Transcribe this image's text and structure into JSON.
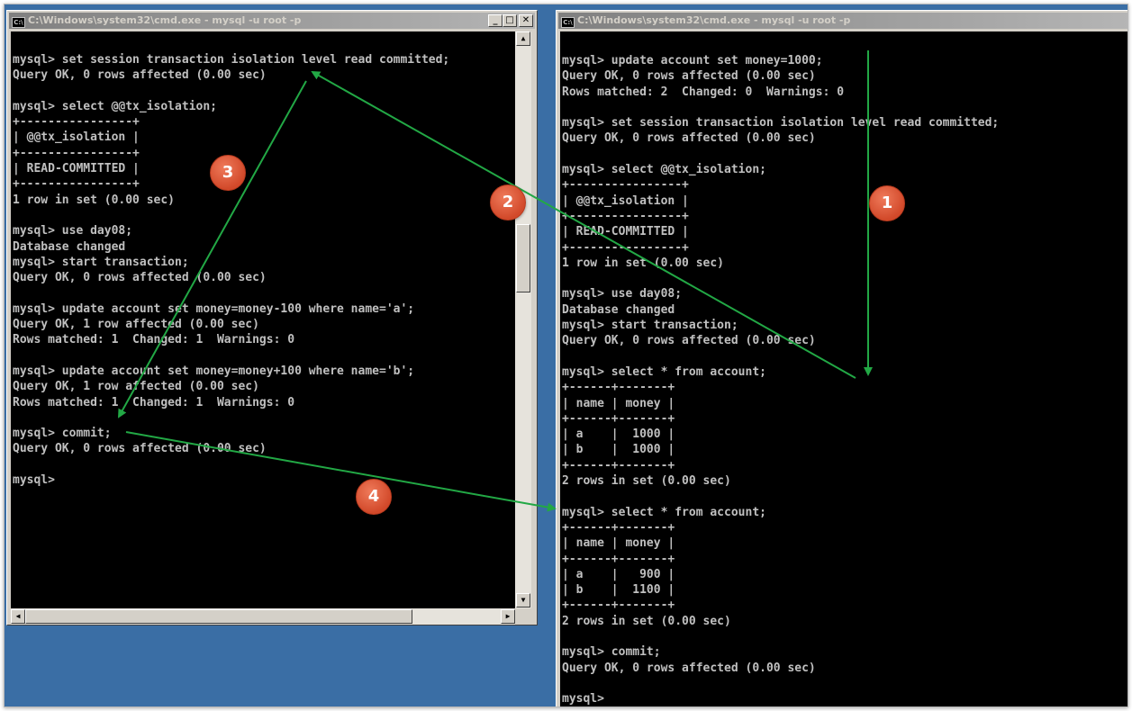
{
  "left_window": {
    "title": "C:\\Windows\\system32\\cmd.exe - mysql  -u root -p",
    "icon": "cmd-icon",
    "buttons": {
      "minimize": "_",
      "maximize": "□",
      "close": "✕"
    },
    "lines": [
      "mysql> set session transaction isolation level read committed;",
      "Query OK, 0 rows affected (0.00 sec)",
      "",
      "mysql> select @@tx_isolation;",
      "+----------------+",
      "| @@tx_isolation |",
      "+----------------+",
      "| READ-COMMITTED |",
      "+----------------+",
      "1 row in set (0.00 sec)",
      "",
      "mysql> use day08;",
      "Database changed",
      "mysql> start transaction;",
      "Query OK, 0 rows affected (0.00 sec)",
      "",
      "mysql> update account set money=money-100 where name='a';",
      "Query OK, 1 row affected (0.00 sec)",
      "Rows matched: 1  Changed: 1  Warnings: 0",
      "",
      "mysql> update account set money=money+100 where name='b';",
      "Query OK, 1 row affected (0.00 sec)",
      "Rows matched: 1  Changed: 1  Warnings: 0",
      "",
      "mysql> commit;",
      "Query OK, 0 rows affected (0.00 sec)",
      "",
      "mysql>"
    ]
  },
  "right_window": {
    "title": "C:\\Windows\\system32\\cmd.exe - mysql  -u root -p",
    "icon": "cmd-icon",
    "lines": [
      "mysql> update account set money=1000;",
      "Query OK, 0 rows affected (0.00 sec)",
      "Rows matched: 2  Changed: 0  Warnings: 0",
      "",
      "mysql> set session transaction isolation level read committed;",
      "Query OK, 0 rows affected (0.00 sec)",
      "",
      "mysql> select @@tx_isolation;",
      "+----------------+",
      "| @@tx_isolation |",
      "+----------------+",
      "| READ-COMMITTED |",
      "+----------------+",
      "1 row in set (0.00 sec)",
      "",
      "mysql> use day08;",
      "Database changed",
      "mysql> start transaction;",
      "Query OK, 0 rows affected (0.00 sec)",
      "",
      "mysql> select * from account;",
      "+------+-------+",
      "| name | money |",
      "+------+-------+",
      "| a    |  1000 |",
      "| b    |  1000 |",
      "+------+-------+",
      "2 rows in set (0.00 sec)",
      "",
      "mysql> select * from account;",
      "+------+-------+",
      "| name | money |",
      "+------+-------+",
      "| a    |   900 |",
      "| b    |  1100 |",
      "+------+-------+",
      "2 rows in set (0.00 sec)",
      "",
      "mysql> commit;",
      "Query OK, 0 rows affected (0.00 sec)",
      "",
      "mysql>"
    ]
  },
  "annotations": {
    "color": "#22a845",
    "badge_color": "#d9502f",
    "steps": [
      "1",
      "2",
      "3",
      "4"
    ]
  }
}
